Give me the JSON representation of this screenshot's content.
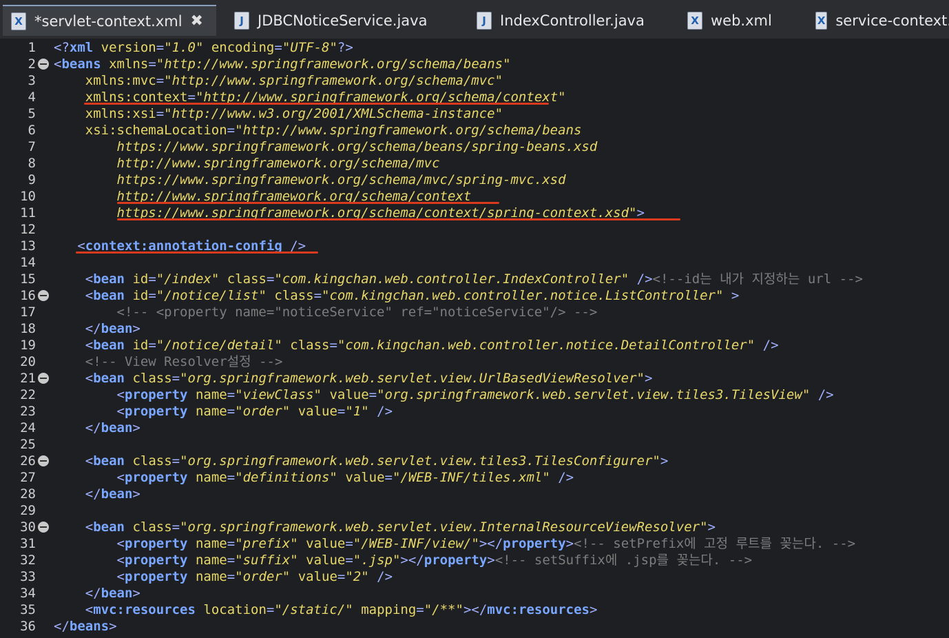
{
  "tabs": [
    {
      "label": "*servlet-context.xml",
      "icon": "xml-file-icon",
      "active": true,
      "closable": true
    },
    {
      "label": "JDBCNoticeService.java",
      "icon": "java-file-icon"
    },
    {
      "label": "IndexController.java",
      "icon": "java-file-icon"
    },
    {
      "label": "web.xml",
      "icon": "xml-file-icon"
    },
    {
      "label": "service-context.",
      "icon": "xml-file-icon"
    }
  ],
  "colors": {
    "annotation_underline": "#d93a1e"
  },
  "editor": {
    "lines": [
      {
        "n": "1",
        "segs": [
          [
            "pun",
            "<?"
          ],
          [
            "tag",
            "xml"
          ],
          [
            "txt",
            " "
          ],
          [
            "att",
            "version"
          ],
          [
            "pun",
            "="
          ],
          [
            "str",
            "\"1.0\""
          ],
          [
            "txt",
            " "
          ],
          [
            "att",
            "encoding"
          ],
          [
            "pun",
            "="
          ],
          [
            "str",
            "\"UTF-8\""
          ],
          [
            "pun",
            "?>"
          ]
        ]
      },
      {
        "n": "2",
        "fold": true,
        "segs": [
          [
            "pun",
            "<"
          ],
          [
            "tag",
            "beans"
          ],
          [
            "txt",
            " "
          ],
          [
            "att",
            "xmlns"
          ],
          [
            "pun",
            "="
          ],
          [
            "str",
            "\"http://www.springframework.org/schema/beans\""
          ]
        ]
      },
      {
        "n": "3",
        "segs": [
          [
            "txt",
            "    "
          ],
          [
            "att",
            "xmlns:mvc"
          ],
          [
            "pun",
            "="
          ],
          [
            "str",
            "\"http://www.springframework.org/schema/mvc\""
          ]
        ]
      },
      {
        "n": "4",
        "segs": [
          [
            "txt",
            "    "
          ],
          [
            "att",
            "xmlns:context"
          ],
          [
            "pun",
            "="
          ],
          [
            "str",
            "\"http://www.springframework.org/schema/context\""
          ]
        ]
      },
      {
        "n": "5",
        "segs": [
          [
            "txt",
            "    "
          ],
          [
            "att",
            "xmlns:xsi"
          ],
          [
            "pun",
            "="
          ],
          [
            "str",
            "\"http://www.w3.org/2001/XMLSchema-instance\""
          ]
        ]
      },
      {
        "n": "6",
        "segs": [
          [
            "txt",
            "    "
          ],
          [
            "att",
            "xsi:schemaLocation"
          ],
          [
            "pun",
            "="
          ],
          [
            "str",
            "\"http://www.springframework.org/schema/beans"
          ]
        ]
      },
      {
        "n": "7",
        "segs": [
          [
            "txt",
            "        "
          ],
          [
            "str",
            "https://www.springframework.org/schema/beans/spring-beans.xsd"
          ]
        ]
      },
      {
        "n": "8",
        "segs": [
          [
            "txt",
            "        "
          ],
          [
            "str",
            "http://www.springframework.org/schema/mvc"
          ]
        ]
      },
      {
        "n": "9",
        "segs": [
          [
            "txt",
            "        "
          ],
          [
            "str",
            "https://www.springframework.org/schema/mvc/spring-mvc.xsd"
          ]
        ]
      },
      {
        "n": "10",
        "segs": [
          [
            "txt",
            "        "
          ],
          [
            "str",
            "http://www.springframework.org/schema/context"
          ]
        ]
      },
      {
        "n": "11",
        "segs": [
          [
            "txt",
            "        "
          ],
          [
            "str",
            "https://www.springframework.org/schema/context/spring-context.xsd\""
          ],
          [
            "pun",
            ">"
          ]
        ]
      },
      {
        "n": "12",
        "segs": []
      },
      {
        "n": "13",
        "segs": [
          [
            "txt",
            "   "
          ],
          [
            "pun",
            "<"
          ],
          [
            "tag",
            "context:annotation-config"
          ],
          [
            "txt",
            " "
          ],
          [
            "pun",
            "/>"
          ]
        ]
      },
      {
        "n": "14",
        "segs": []
      },
      {
        "n": "15",
        "segs": [
          [
            "txt",
            "    "
          ],
          [
            "pun",
            "<"
          ],
          [
            "tag",
            "bean"
          ],
          [
            "txt",
            " "
          ],
          [
            "att",
            "id"
          ],
          [
            "pun",
            "="
          ],
          [
            "str",
            "\"/index\""
          ],
          [
            "txt",
            " "
          ],
          [
            "att",
            "class"
          ],
          [
            "pun",
            "="
          ],
          [
            "str",
            "\"com.kingchan.web.controller.IndexController\""
          ],
          [
            "txt",
            " "
          ],
          [
            "pun",
            "/>"
          ],
          [
            "cmt",
            "<!--id는 내가 지정하는 url -->"
          ]
        ]
      },
      {
        "n": "16",
        "fold": true,
        "segs": [
          [
            "txt",
            "    "
          ],
          [
            "pun",
            "<"
          ],
          [
            "tag",
            "bean"
          ],
          [
            "txt",
            " "
          ],
          [
            "att",
            "id"
          ],
          [
            "pun",
            "="
          ],
          [
            "str",
            "\"/notice/list\""
          ],
          [
            "txt",
            " "
          ],
          [
            "att",
            "class"
          ],
          [
            "pun",
            "="
          ],
          [
            "str",
            "\"com.kingchan.web.controller.notice.ListController\""
          ],
          [
            "txt",
            " "
          ],
          [
            "pun",
            ">"
          ]
        ]
      },
      {
        "n": "17",
        "segs": [
          [
            "txt",
            "        "
          ],
          [
            "cmt",
            "<!-- <property name=\"noticeService\" ref=\"noticeService\"/> -->"
          ]
        ]
      },
      {
        "n": "18",
        "segs": [
          [
            "txt",
            "    "
          ],
          [
            "pun",
            "</"
          ],
          [
            "tag",
            "bean"
          ],
          [
            "pun",
            ">"
          ]
        ]
      },
      {
        "n": "19",
        "segs": [
          [
            "txt",
            "    "
          ],
          [
            "pun",
            "<"
          ],
          [
            "tag",
            "bean"
          ],
          [
            "txt",
            " "
          ],
          [
            "att",
            "id"
          ],
          [
            "pun",
            "="
          ],
          [
            "str",
            "\"/notice/detail\""
          ],
          [
            "txt",
            " "
          ],
          [
            "att",
            "class"
          ],
          [
            "pun",
            "="
          ],
          [
            "str",
            "\"com.kingchan.web.controller.notice.DetailController\""
          ],
          [
            "txt",
            " "
          ],
          [
            "pun",
            "/>"
          ]
        ]
      },
      {
        "n": "20",
        "segs": [
          [
            "txt",
            "    "
          ],
          [
            "cmt",
            "<!-- View Resolver설정 -->"
          ]
        ]
      },
      {
        "n": "21",
        "fold": true,
        "segs": [
          [
            "txt",
            "    "
          ],
          [
            "pun",
            "<"
          ],
          [
            "tag",
            "bean"
          ],
          [
            "txt",
            " "
          ],
          [
            "att",
            "class"
          ],
          [
            "pun",
            "="
          ],
          [
            "str",
            "\"org.springframework.web.servlet.view.UrlBasedViewResolver\""
          ],
          [
            "pun",
            ">"
          ]
        ]
      },
      {
        "n": "22",
        "segs": [
          [
            "txt",
            "        "
          ],
          [
            "pun",
            "<"
          ],
          [
            "tag",
            "property"
          ],
          [
            "txt",
            " "
          ],
          [
            "att",
            "name"
          ],
          [
            "pun",
            "="
          ],
          [
            "str",
            "\"viewClass\""
          ],
          [
            "txt",
            " "
          ],
          [
            "att",
            "value"
          ],
          [
            "pun",
            "="
          ],
          [
            "str",
            "\"org.springframework.web.servlet.view.tiles3.TilesView\""
          ],
          [
            "txt",
            " "
          ],
          [
            "pun",
            "/>"
          ]
        ]
      },
      {
        "n": "23",
        "segs": [
          [
            "txt",
            "        "
          ],
          [
            "pun",
            "<"
          ],
          [
            "tag",
            "property"
          ],
          [
            "txt",
            " "
          ],
          [
            "att",
            "name"
          ],
          [
            "pun",
            "="
          ],
          [
            "str",
            "\"order\""
          ],
          [
            "txt",
            " "
          ],
          [
            "att",
            "value"
          ],
          [
            "pun",
            "="
          ],
          [
            "str",
            "\"1\""
          ],
          [
            "txt",
            " "
          ],
          [
            "pun",
            "/>"
          ]
        ]
      },
      {
        "n": "24",
        "segs": [
          [
            "txt",
            "    "
          ],
          [
            "pun",
            "</"
          ],
          [
            "tag",
            "bean"
          ],
          [
            "pun",
            ">"
          ]
        ]
      },
      {
        "n": "25",
        "segs": []
      },
      {
        "n": "26",
        "fold": true,
        "segs": [
          [
            "txt",
            "    "
          ],
          [
            "pun",
            "<"
          ],
          [
            "tag",
            "bean"
          ],
          [
            "txt",
            " "
          ],
          [
            "att",
            "class"
          ],
          [
            "pun",
            "="
          ],
          [
            "str",
            "\"org.springframework.web.servlet.view.tiles3.TilesConfigurer\""
          ],
          [
            "pun",
            ">"
          ]
        ]
      },
      {
        "n": "27",
        "segs": [
          [
            "txt",
            "        "
          ],
          [
            "pun",
            "<"
          ],
          [
            "tag",
            "property"
          ],
          [
            "txt",
            " "
          ],
          [
            "att",
            "name"
          ],
          [
            "pun",
            "="
          ],
          [
            "str",
            "\"definitions\""
          ],
          [
            "txt",
            " "
          ],
          [
            "att",
            "value"
          ],
          [
            "pun",
            "="
          ],
          [
            "str",
            "\"/WEB-INF/tiles.xml\""
          ],
          [
            "txt",
            " "
          ],
          [
            "pun",
            "/>"
          ]
        ]
      },
      {
        "n": "28",
        "segs": [
          [
            "txt",
            "    "
          ],
          [
            "pun",
            "</"
          ],
          [
            "tag",
            "bean"
          ],
          [
            "pun",
            ">"
          ]
        ]
      },
      {
        "n": "29",
        "segs": []
      },
      {
        "n": "30",
        "fold": true,
        "segs": [
          [
            "txt",
            "    "
          ],
          [
            "pun",
            "<"
          ],
          [
            "tag",
            "bean"
          ],
          [
            "txt",
            " "
          ],
          [
            "att",
            "class"
          ],
          [
            "pun",
            "="
          ],
          [
            "str",
            "\"org.springframework.web.servlet.view.InternalResourceViewResolver\""
          ],
          [
            "pun",
            ">"
          ]
        ]
      },
      {
        "n": "31",
        "segs": [
          [
            "txt",
            "        "
          ],
          [
            "pun",
            "<"
          ],
          [
            "tag",
            "property"
          ],
          [
            "txt",
            " "
          ],
          [
            "att",
            "name"
          ],
          [
            "pun",
            "="
          ],
          [
            "str",
            "\"prefix\""
          ],
          [
            "txt",
            " "
          ],
          [
            "att",
            "value"
          ],
          [
            "pun",
            "="
          ],
          [
            "str",
            "\"/WEB-INF/view/\""
          ],
          [
            "pun",
            "></"
          ],
          [
            "tag",
            "property"
          ],
          [
            "pun",
            ">"
          ],
          [
            "cmt",
            "<!-- setPrefix에 고정 루트를 꽂는다. -->"
          ]
        ]
      },
      {
        "n": "32",
        "segs": [
          [
            "txt",
            "        "
          ],
          [
            "pun",
            "<"
          ],
          [
            "tag",
            "property"
          ],
          [
            "txt",
            " "
          ],
          [
            "att",
            "name"
          ],
          [
            "pun",
            "="
          ],
          [
            "str",
            "\"suffix\""
          ],
          [
            "txt",
            " "
          ],
          [
            "att",
            "value"
          ],
          [
            "pun",
            "="
          ],
          [
            "str",
            "\".jsp\""
          ],
          [
            "pun",
            "></"
          ],
          [
            "tag",
            "property"
          ],
          [
            "pun",
            ">"
          ],
          [
            "cmt",
            "<!-- setSuffix에 .jsp를 꽂는다. -->"
          ]
        ]
      },
      {
        "n": "33",
        "segs": [
          [
            "txt",
            "        "
          ],
          [
            "pun",
            "<"
          ],
          [
            "tag",
            "property"
          ],
          [
            "txt",
            " "
          ],
          [
            "att",
            "name"
          ],
          [
            "pun",
            "="
          ],
          [
            "str",
            "\"order\""
          ],
          [
            "txt",
            " "
          ],
          [
            "att",
            "value"
          ],
          [
            "pun",
            "="
          ],
          [
            "str",
            "\"2\""
          ],
          [
            "txt",
            " "
          ],
          [
            "pun",
            "/>"
          ]
        ]
      },
      {
        "n": "34",
        "segs": [
          [
            "txt",
            "    "
          ],
          [
            "pun",
            "</"
          ],
          [
            "tag",
            "bean"
          ],
          [
            "pun",
            ">"
          ]
        ]
      },
      {
        "n": "35",
        "segs": [
          [
            "txt",
            "    "
          ],
          [
            "pun",
            "<"
          ],
          [
            "tag",
            "mvc:resources"
          ],
          [
            "txt",
            " "
          ],
          [
            "att",
            "location"
          ],
          [
            "pun",
            "="
          ],
          [
            "str",
            "\"/static/\""
          ],
          [
            "txt",
            " "
          ],
          [
            "att",
            "mapping"
          ],
          [
            "pun",
            "="
          ],
          [
            "str",
            "\"/**\""
          ],
          [
            "pun",
            "></"
          ],
          [
            "tag",
            "mvc:resources"
          ],
          [
            "pun",
            ">"
          ]
        ]
      },
      {
        "n": "36",
        "segs": [
          [
            "pun",
            "</"
          ],
          [
            "tag",
            "beans"
          ],
          [
            "pun",
            ">"
          ]
        ]
      }
    ]
  }
}
